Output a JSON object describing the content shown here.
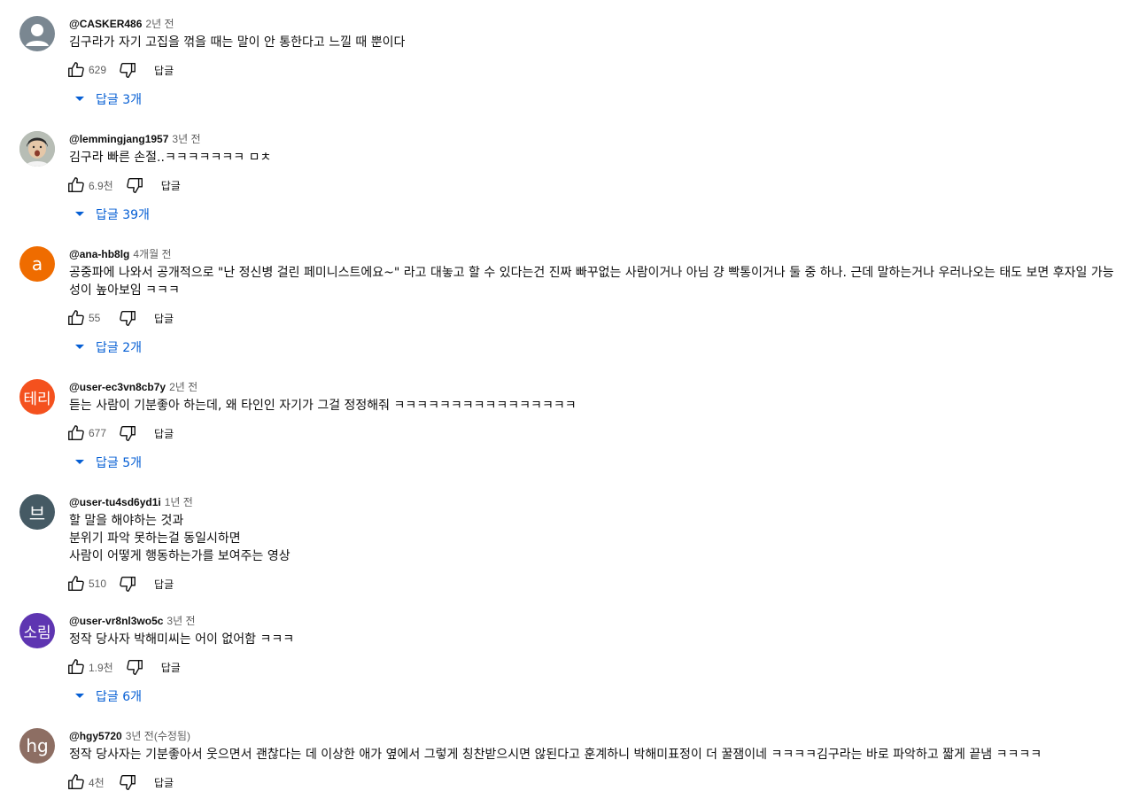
{
  "comments": [
    {
      "author": "@CASKER486",
      "time": "2년 전",
      "text": "김구라가 자기 고집을 꺾을 때는 말이 안 통한다고 느낄 때 뿐이다",
      "likes": "629",
      "reply_label": "답글",
      "replies": "답글 3개",
      "avatar": {
        "type": "default-person-icon",
        "color": "#7a8791"
      }
    },
    {
      "author": "@lemmingjang1957",
      "time": "3년 전",
      "text": "김구라 빠른 손절..ㅋㅋㅋㅋㅋㅋㅋ ㅁㅊ",
      "likes": "6.9천",
      "reply_label": "답글",
      "replies": "답글 39개",
      "avatar": {
        "type": "photo",
        "color": "#9aa39a"
      }
    },
    {
      "author": "@ana-hb8lg",
      "time": "4개월 전",
      "text": "공중파에 나와서 공개적으로 \"난 정신병 걸린 페미니스트에요~\" 라고 대놓고 할 수 있다는건 진짜 빠꾸없는 사람이거나 아님 걍 빡통이거나 둘 중 하나. 근데 말하는거나 우러나오는 태도 보면 후자일 가능성이 높아보임 ㅋㅋㅋ",
      "likes": "55",
      "reply_label": "답글",
      "replies": "답글 2개",
      "avatar": {
        "letter": "a",
        "color": "#ef6c00"
      }
    },
    {
      "author": "@user-ec3vn8cb7y",
      "time": "2년 전",
      "text": "듣는 사람이 기분좋아 하는데, 왜 타인인 자기가 그걸 정정해줘 ㅋㅋㅋㅋㅋㅋㅋㅋㅋㅋㅋㅋㅋㅋㅋㅋ",
      "likes": "677",
      "reply_label": "답글",
      "replies": "답글 5개",
      "avatar": {
        "letter": "테리",
        "color": "#f4511e"
      }
    },
    {
      "author": "@user-tu4sd6yd1i",
      "time": "1년 전",
      "text": "할 말을 해야하는 것과\n분위기 파악 못하는걸 동일시하면\n사람이 어떻게 행동하는가를 보여주는 영상",
      "likes": "510",
      "reply_label": "답글",
      "replies": "",
      "avatar": {
        "letter": "브",
        "color": "#455a64"
      }
    },
    {
      "author": "@user-vr8nl3wo5c",
      "time": "3년 전",
      "text": "정작 당사자 박해미씨는 어이 없어함 ㅋㅋㅋ",
      "likes": "1.9천",
      "reply_label": "답글",
      "replies": "답글 6개",
      "avatar": {
        "letter": "소림",
        "color": "#5e35b1"
      }
    },
    {
      "author": "@hgy5720",
      "time": "3년 전(수정됨)",
      "text": "정작 당사자는 기분좋아서 웃으면서 괜찮다는 데 이상한 애가 옆에서 그렇게 칭찬받으시면 않된다고 훈계하니 박해미표정이 더 꿀잼이네 ㅋㅋㅋㅋ김구라는 바로 파악하고 짧게 끝냄 ㅋㅋㅋㅋ",
      "likes": "4천",
      "reply_label": "답글",
      "replies": "",
      "avatar": {
        "letter": "hg",
        "color": "#8d6e63"
      }
    }
  ]
}
